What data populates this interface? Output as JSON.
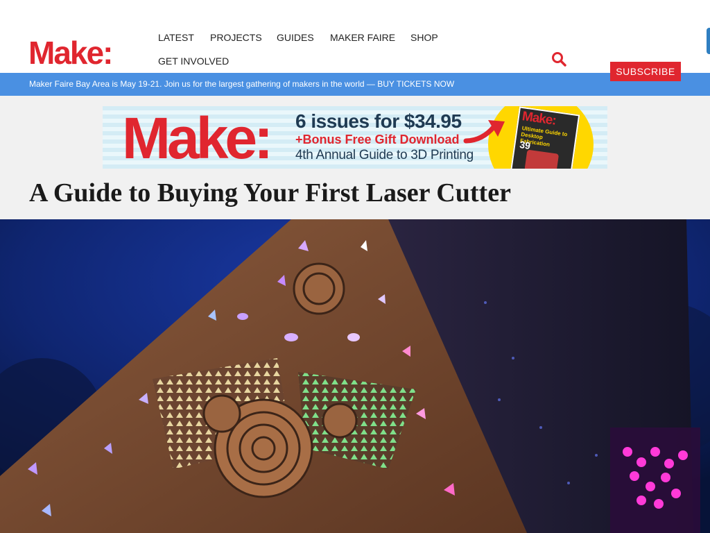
{
  "brand": {
    "logo": "Make:",
    "accent": "#e0262f",
    "bar_color": "#4a90e2"
  },
  "nav": {
    "items": [
      {
        "label": "LATEST"
      },
      {
        "label": "PROJECTS"
      },
      {
        "label": "GUIDES"
      },
      {
        "label": "MAKER FAIRE"
      },
      {
        "label": "SHOP"
      },
      {
        "label": "GET INVOLVED"
      }
    ],
    "search_icon": "search-icon",
    "subscribe_label": "SUBSCRIBE"
  },
  "announcement": {
    "text": "Maker Faire Bay Area is May 19-21. Join us for the largest gathering of makers in the world — ",
    "link": "BUY TICKETS NOW"
  },
  "ad": {
    "logo": "Make:",
    "line1": "6 issues for $34.95",
    "line2": "+Bonus Free Gift Download",
    "line3": "4th Annual Guide to 3D Printing",
    "magazine_brand": "Make:",
    "magazine_headline": "Ultimate Guide to Desktop Fabrication",
    "magazine_number": "39"
  },
  "article": {
    "title": "A Guide to Buying Your First Laser Cutter"
  }
}
